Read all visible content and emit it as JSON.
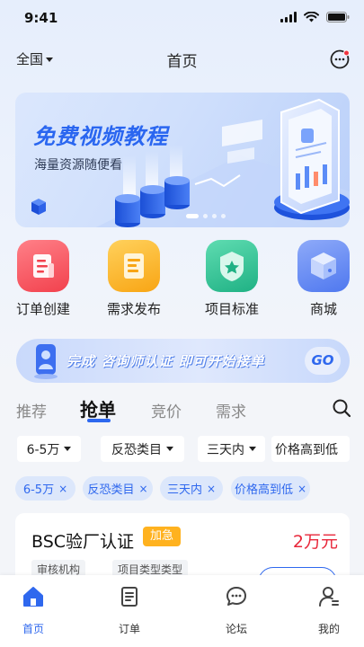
{
  "status_bar": {
    "time": "9:41"
  },
  "header": {
    "region": "全国",
    "title": "首页"
  },
  "banner": {
    "title": "免费视频教程",
    "subtitle": "海量资源随便看",
    "slide_count": 4,
    "active_slide": 1
  },
  "quick_actions": [
    {
      "label": "订单创建",
      "icon": "order-create-icon",
      "color": "#f4545e"
    },
    {
      "label": "需求发布",
      "icon": "demand-publish-icon",
      "color": "#fbb21d"
    },
    {
      "label": "项目标准",
      "icon": "project-standard-icon",
      "color": "#2dc293"
    },
    {
      "label": "商城",
      "icon": "mall-box-icon",
      "color": "#5f86f3"
    }
  ],
  "consultant_banner": {
    "text_1": "完成",
    "text_2": "咨询师认证",
    "text_3": "即可开始接单",
    "go_label": "GO"
  },
  "tabs": [
    {
      "label": "推荐",
      "active": false
    },
    {
      "label": "抢单",
      "active": true
    },
    {
      "label": "竞价",
      "active": false
    },
    {
      "label": "需求",
      "active": false
    }
  ],
  "filters": [
    {
      "label": "6-5万"
    },
    {
      "label": "反恐类目"
    },
    {
      "label": "三天内"
    },
    {
      "label": "价格高到低"
    }
  ],
  "selected_chips": [
    {
      "label": "6-5万",
      "remove": "×"
    },
    {
      "label": "反恐类目",
      "remove": "×"
    },
    {
      "label": "三天内",
      "remove": "×"
    },
    {
      "label": "价格高到低",
      "remove": "×"
    }
  ],
  "order_card": {
    "title": "BSC验厂认证",
    "badge": "加急",
    "price": "2万元",
    "tag_1": "审核机构",
    "tag_2": "项目类型类型"
  },
  "bottom_nav": [
    {
      "label": "首页",
      "icon": "home-icon",
      "active": true
    },
    {
      "label": "订单",
      "icon": "order-icon",
      "active": false
    },
    {
      "label": "论坛",
      "icon": "forum-icon",
      "active": false
    },
    {
      "label": "我的",
      "icon": "profile-icon",
      "active": false
    }
  ],
  "colors": {
    "accent": "#2f68ee",
    "price": "#e8273a",
    "urgent": "#ffb21f"
  }
}
